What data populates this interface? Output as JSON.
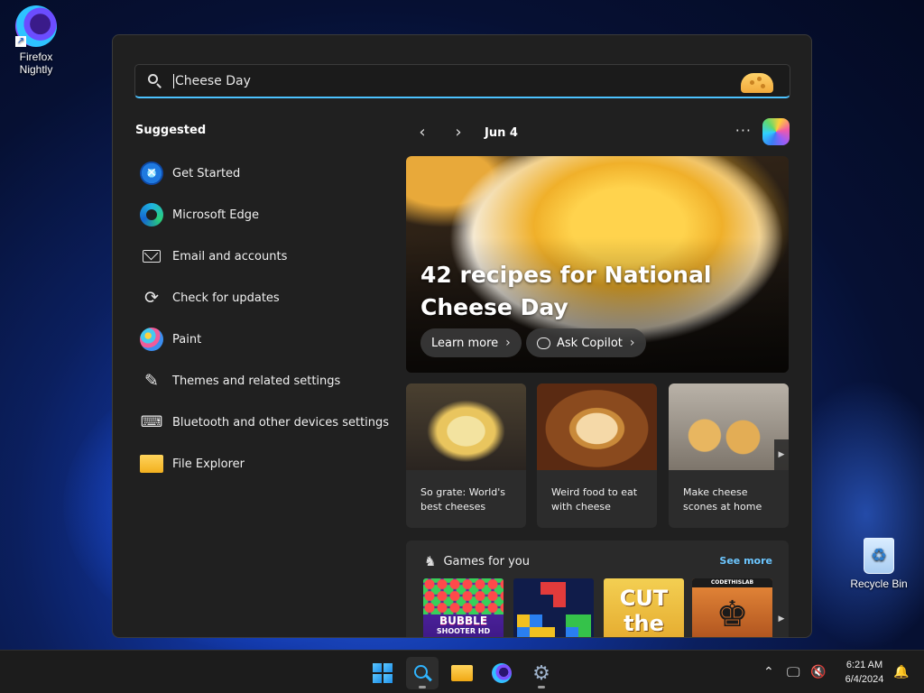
{
  "desktop": {
    "icons": [
      {
        "label_line1": "Firefox",
        "label_line2": "Nightly",
        "icon": "firefox-nightly-icon"
      },
      {
        "label": "Recycle Bin",
        "icon": "recycle-bin-icon"
      }
    ]
  },
  "search": {
    "value": "Cheese Day",
    "highlight_icon": "cheese-icon"
  },
  "suggested": {
    "title": "Suggested",
    "items": [
      {
        "label": "Get Started",
        "icon": "get-started-icon"
      },
      {
        "label": "Microsoft Edge",
        "icon": "edge-icon"
      },
      {
        "label": "Email and accounts",
        "icon": "mail-icon"
      },
      {
        "label": "Check for updates",
        "icon": "refresh-icon"
      },
      {
        "label": "Paint",
        "icon": "paint-icon"
      },
      {
        "label": "Themes and related settings",
        "icon": "brush-icon"
      },
      {
        "label": "Bluetooth and other devices settings",
        "icon": "devices-icon"
      },
      {
        "label": "File Explorer",
        "icon": "folder-icon"
      }
    ]
  },
  "highlights": {
    "date": "Jun 4",
    "more_glyph": "···",
    "hero": {
      "title": "42 recipes for National Cheese Day",
      "learn_more": "Learn more",
      "ask_copilot": "Ask Copilot"
    },
    "cards": [
      {
        "text": "So grate: World's best cheeses"
      },
      {
        "text": "Weird food to eat with cheese"
      },
      {
        "text": "Make cheese scones at home"
      }
    ],
    "games": {
      "title": "Games for you",
      "see_more": "See more",
      "tiles": [
        {
          "title": "BUBBLE",
          "subtitle": "SHOOTER HD"
        },
        {
          "title": ""
        },
        {
          "title": "CUT the ROPE"
        },
        {
          "title": "CODETHISLAB"
        }
      ]
    }
  },
  "taskbar": {
    "apps": [
      "start-icon",
      "search-icon",
      "file-explorer-icon",
      "firefox-icon",
      "settings-icon"
    ],
    "clock": {
      "time": "6:21 AM",
      "date": "6/4/2024"
    }
  },
  "colors": {
    "accent": "#4cc2ff",
    "panel_bg": "#202020",
    "link": "#6cc6ff"
  }
}
